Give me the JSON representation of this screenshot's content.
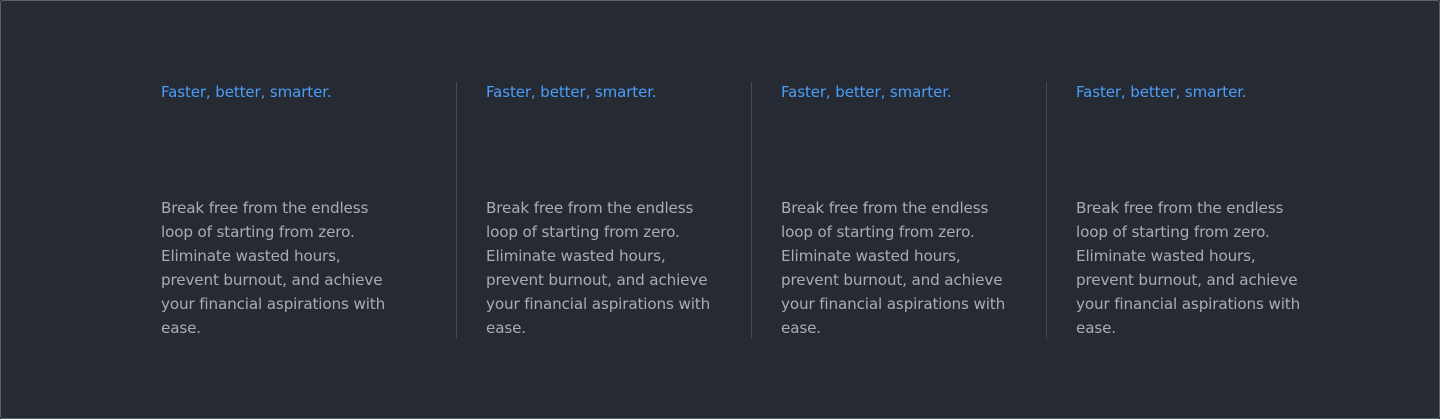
{
  "features": [
    {
      "title": "Faster, better, smarter.",
      "description": "Break free from the endless loop of starting from zero. Eliminate wasted hours, prevent burnout, and achieve your financial aspirations with ease."
    },
    {
      "title": "Faster, better, smarter.",
      "description": "Break free from the endless loop of starting from zero. Eliminate wasted hours, prevent burnout, and achieve your financial aspirations with ease."
    },
    {
      "title": "Faster, better, smarter.",
      "description": "Break free from the endless loop of starting from zero. Eliminate wasted hours, prevent burnout, and achieve your financial aspirations with ease."
    },
    {
      "title": "Faster, better, smarter.",
      "description": "Break free from the endless loop of starting from zero. Eliminate wasted hours, prevent burnout, and achieve your financial aspirations with ease."
    }
  ],
  "colors": {
    "background": "#262b33",
    "accent": "#4a9df8",
    "body_text": "#a9adb3",
    "divider": "#444a53"
  }
}
